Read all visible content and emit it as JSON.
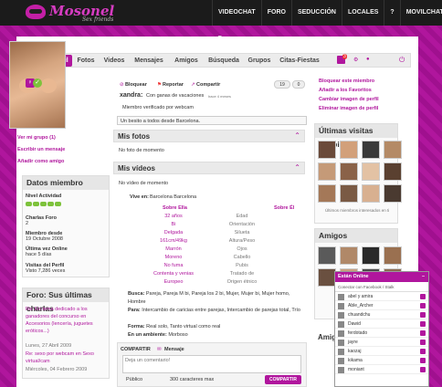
{
  "brand": {
    "name": "Mosonel",
    "tagline": "Sex friends"
  },
  "topnav": [
    "VIDEOCHAT ▾",
    "FORO",
    "SEDUCCIÓN",
    "LOCALES",
    "?",
    "MOVILCHAT"
  ],
  "tabs": [
    "Tu Perfil",
    "Fotos",
    "Videos",
    "Mensajes",
    "Amigos",
    "Búsqueda",
    "Grupos",
    "Citas-Fiestas"
  ],
  "tab_badges": {
    "mail": "3",
    "alert": "4"
  },
  "left": {
    "links": [
      "Ver mi grupo (1)",
      "Escribir un mensaje",
      "Añadir como amigo"
    ],
    "datos_title": "Datos miembro",
    "nivel_label": "Nivel Actividad",
    "charlas_label": "Charlas Foro",
    "charlas_value": "2",
    "miembro_label": "Miembro desde",
    "miembro_value": "19 Octubre 2008",
    "ultima_label": "Última vez Online",
    "ultima_value": "hace 5 días",
    "visitas_label": "Visitas del Perfil",
    "visitas_value": "Visto 7,286 veces",
    "foro_title": "Foro: Sus últimas charlas",
    "posts": [
      {
        "title": "Re: En tema dedicado a los ganadores del concurso en Accesorios (lencería, juguetes eróticos...)",
        "date": "Lunes, 27 Abril 2009"
      },
      {
        "title": "Re: sexo por webcam en Sexo virtual/cam",
        "date": "Miércoles, 04 Febrero 2009"
      }
    ]
  },
  "center": {
    "actions": [
      "Bloquear",
      "Reportar",
      "Compartir"
    ],
    "likes": "19",
    "dislikes": "0",
    "username": "xandra:",
    "status": "Con ganas de vacaciones",
    "status_time": "hace 4 meses",
    "verified": "Miembro verificado por webcam",
    "greeting": "Un besito a todos desde Barcelona.",
    "fotos_title": "Mis fotos",
    "fotos_empty": "No foto de momento",
    "videos_title": "Mis vídeos",
    "videos_empty": "No vídeo de momento",
    "vive_label": "Vive en:",
    "vive_value": "Barcelona Barcelona",
    "sobre_ella": "Sobre Ella",
    "sobre_el": "Sobre Él",
    "fields": [
      "Edad",
      "Orientación",
      "Silueta",
      "Altura/Peso",
      "Ojos",
      "Cabello",
      "Pubis",
      "Tratado de",
      "Origen étnico"
    ],
    "values": [
      "32 años",
      "Bi",
      "Delgada",
      "161cm/49kg",
      "Marrón",
      "Moreno",
      "No fuma",
      "Contenta y venias",
      "Europeo"
    ],
    "busca_label": "Busca:",
    "busca_value": "Pareja, Pareja M bi, Pareja los 2 bi, Mujer, Mujer bi, Mujer homo, Hombre",
    "para_label": "Para:",
    "para_value": "Intercambio de caricias entre parejas, Intercambio de parejas total, Trío",
    "forma_label": "Forma:",
    "forma_value": "Real solo, Tanto virtual como real",
    "ambiente_label": "En un ambiente:",
    "ambiente_value": "Morboso",
    "compartir_label": "COMPARTIR",
    "mensaje_label": "Mensaje",
    "comment_placeholder": "Deja un comentario!",
    "privacy": "Público",
    "chars_left": "300 caracteres max",
    "publish": "COMPARTIR"
  },
  "right": {
    "links": [
      "Bloquear este miembro",
      "Añadir a los Favoritos",
      "Cambiar imagen de perfil",
      "Eliminar imagen de perfil"
    ],
    "visits_title": "Últimas visitas recibidas",
    "visits_caption": "Últimos miembros interesados en ti",
    "friends_title": "Amigos",
    "amigos2_title": "Amig"
  },
  "chat": {
    "title": "Están Online",
    "subtitle": "Conectar con Facebook / Stalk",
    "users": [
      "abel y amira",
      "Able_Archer",
      "chuandchu",
      "Dawid",
      "ferdotado",
      "jayre",
      "kaozaj",
      "kikama",
      "moniant"
    ]
  },
  "colors": {
    "brand": "#b0169d",
    "topbar": "#1b1b1b",
    "ok": "#7dc23b"
  }
}
